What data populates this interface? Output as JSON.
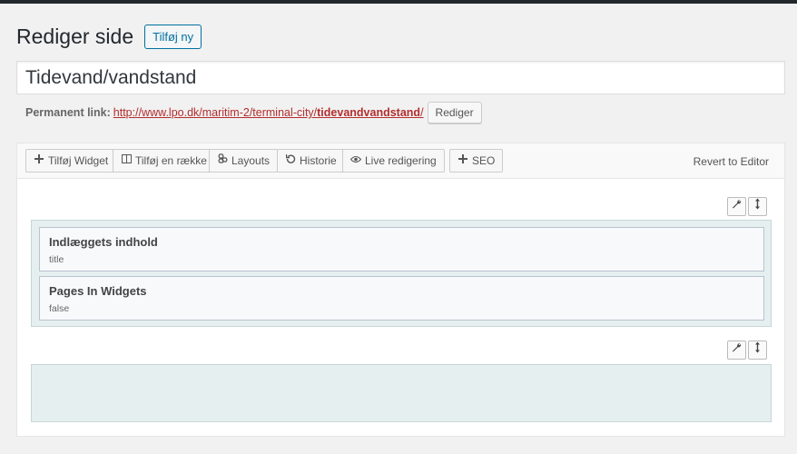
{
  "header": {
    "title": "Rediger side",
    "add_new_label": "Tilføj ny"
  },
  "post": {
    "title_value": "Tidevand/vandstand"
  },
  "permalink": {
    "label": "Permanent link:",
    "url_base": "http://www.lpo.dk/maritim-2/terminal-city/",
    "slug": "tidevandvandstand",
    "url_trailing": "/",
    "edit_label": "Rediger"
  },
  "toolbar": {
    "add_widget": "Tilføj Widget",
    "add_row": "Tilføj en række",
    "layouts": "Layouts",
    "history": "Historie",
    "live_edit": "Live redigering",
    "seo": "SEO",
    "revert": "Revert to Editor"
  },
  "rows": [
    {
      "widgets": [
        {
          "title": "Indlæggets indhold",
          "description": "title"
        },
        {
          "title": "Pages In Widgets",
          "description": "false"
        }
      ]
    },
    {
      "widgets": []
    }
  ],
  "icons": {
    "wrench": "wrench-icon",
    "move": "move-icon"
  }
}
